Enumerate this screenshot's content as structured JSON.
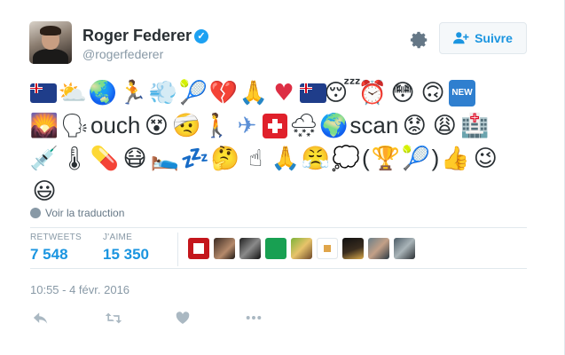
{
  "tweet": {
    "author_name": "Roger Federer",
    "author_handle": "@rogerfederer",
    "follow_label": "Suivre",
    "content_words": {
      "ouch": "ouch",
      "scan": "scan",
      "paren_open": "(",
      "paren_close": ")"
    },
    "translate_label": "Voir la traduction",
    "stats": {
      "retweets_label": "RETWEETS",
      "retweets_value": "7 548",
      "likes_label": "J'AIME",
      "likes_value": "15 350"
    },
    "timestamp": "10:55 - 4 févr. 2016"
  },
  "icons": [
    "verified-icon",
    "gear-icon",
    "add-user-icon",
    "globe-icon",
    "reply-icon",
    "retweet-icon",
    "like-icon",
    "more-icon"
  ],
  "colors": {
    "accent": "#1b95e0",
    "verified": "#1da1f2",
    "muted": "#8899a6"
  }
}
